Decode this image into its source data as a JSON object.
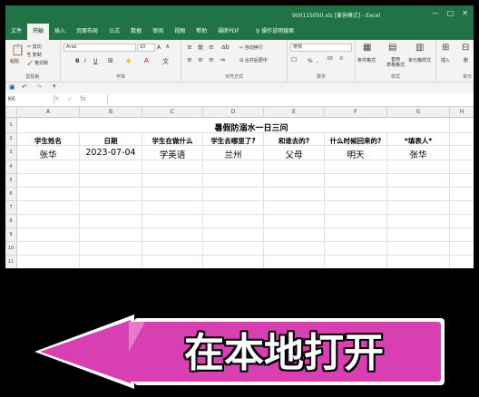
{
  "window": {
    "title": "900115050.xls [兼容模式]  -  Excel",
    "controls": [
      "—",
      "□",
      "✕"
    ]
  },
  "ribbon_tabs": [
    "文件",
    "开始",
    "插入",
    "页面布局",
    "公式",
    "数据",
    "审阅",
    "视图",
    "帮助",
    "福昕PDF"
  ],
  "tell_me": "操作说明搜索",
  "ribbon": {
    "clipboard": {
      "paste": "粘贴",
      "cut": "剪切",
      "copy": "复制",
      "format_painter": "格式刷",
      "label": "剪贴板"
    },
    "font": {
      "name": "Arial",
      "size": "10",
      "grow": "A",
      "shrink": "A",
      "bold": "B",
      "italic": "I",
      "underline": "U",
      "label": "字体"
    },
    "alignment": {
      "wrap": "自动换行",
      "merge": "合并后居中",
      "label": "对齐方式"
    },
    "number": {
      "format": "常规",
      "percent": "%",
      "comma": ",",
      "label": "数字"
    },
    "styles": {
      "conditional": "条件格式",
      "table": "套用\n表格格式",
      "cell": "单元格样式",
      "label": "样式"
    },
    "cells": {
      "insert": "插入",
      "delete": "删",
      "label": "单元"
    }
  },
  "formula_bar": {
    "name_box": "K6",
    "fx": "fx",
    "value": ""
  },
  "sheet": {
    "columns": [
      "A",
      "B",
      "C",
      "D",
      "E",
      "F",
      "G",
      "H"
    ],
    "rows": [
      "1",
      "2",
      "3",
      "4",
      "5",
      "6",
      "7",
      "8",
      "9",
      "10",
      "11"
    ],
    "title": "暑假防溺水一日三问",
    "headers": [
      "学生姓名",
      "日期",
      "学生在做什么",
      "学生去哪里了?",
      "和谁去的?",
      "什么时候回来的?",
      "*填表人*"
    ],
    "values": [
      "张华",
      "2023-07-04",
      "学英语",
      "兰州",
      "父母",
      "明天",
      "张华"
    ]
  },
  "banner": {
    "label": "在本地打开",
    "color": "#d83fb2"
  }
}
